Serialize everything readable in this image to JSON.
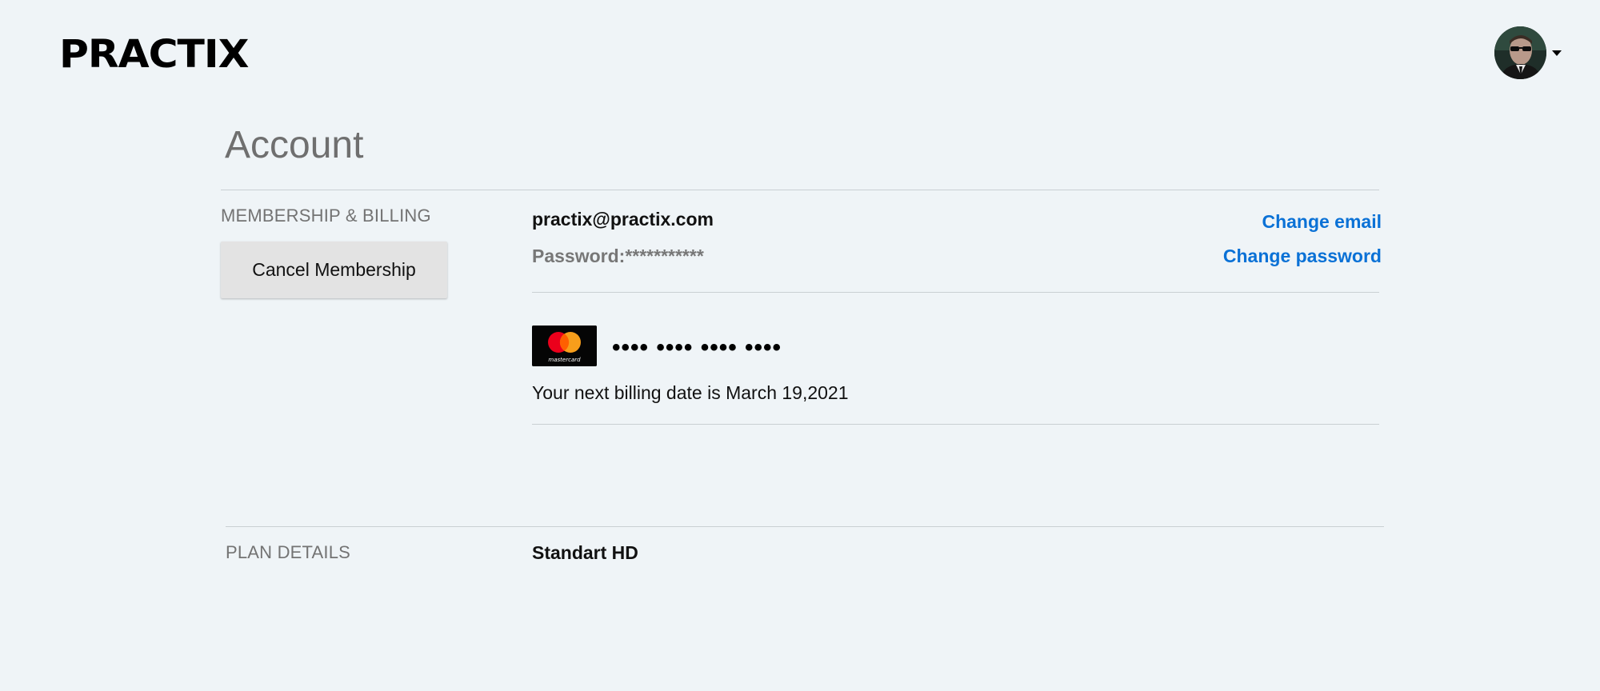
{
  "header": {
    "logo": "PRACTIX",
    "avatar_alt": "user-avatar"
  },
  "account": {
    "title": "Account",
    "membership": {
      "section_label": "MEMBERSHIP & BILLING",
      "cancel_label": "Cancel Membership",
      "email": "practix@practix.com",
      "password": "Password:***********",
      "change_email_label": "Change email",
      "change_password_label": "Change password",
      "card_brand": "mastercard",
      "card_number": "•••• •••• •••• ••••",
      "billing_text": "Your next billing date is March 19,2021"
    },
    "plan": {
      "section_label": "PLAN DETAILS",
      "plan_name": "Standart HD"
    }
  },
  "colors": {
    "background": "#eff4f7",
    "link": "#0a71d6",
    "muted": "#737373",
    "rule": "#c9cfd3"
  }
}
